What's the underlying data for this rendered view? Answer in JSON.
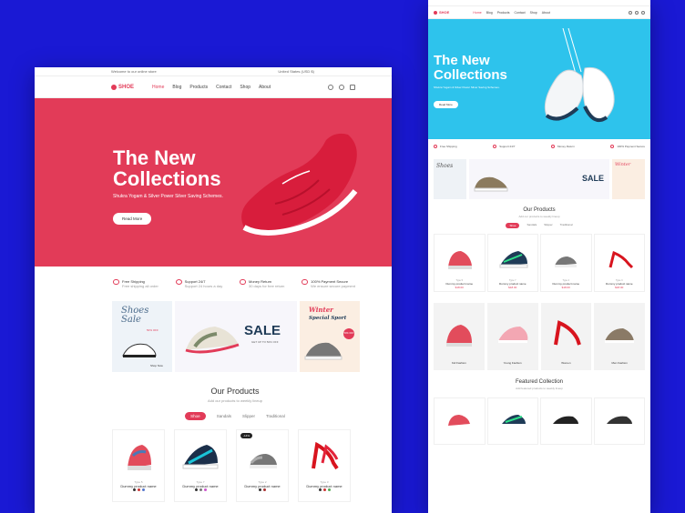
{
  "front": {
    "topbar": {
      "welcome": "Welcome to our online store",
      "region": "United States (USD $)"
    },
    "logo": "SHOE",
    "menu": [
      "Home",
      "Blog",
      "Products",
      "Contact",
      "Shop",
      "About"
    ],
    "hero": {
      "title_line1": "The New",
      "title_line2": "Collections",
      "subtitle": "Shukra Yogam & Silver Power Silver Saving Schemes.",
      "button": "Read More",
      "bg": "#e23b58"
    },
    "features": [
      {
        "title": "Free Shipping",
        "sub": "Free shipping all order"
      },
      {
        "title": "Support 24/7",
        "sub": "Support 24 hours a day"
      },
      {
        "title": "Money Return",
        "sub": "30 days for free return"
      },
      {
        "title": "100% Payment Secure",
        "sub": "We ensure secure payment"
      }
    ],
    "banners": {
      "shoes_sale": {
        "line1": "Shoes",
        "line2": "Sale",
        "badge": "50% OFF",
        "link": "Shop Now"
      },
      "sale": {
        "title": "SALE",
        "sub": "GET UP TO 50% OFF"
      },
      "winter": {
        "line1": "Winter",
        "line2": "Special Sport",
        "badge": "50% OFF"
      }
    },
    "products": {
      "title": "Our Products",
      "subtitle": "Add our products to weekly lineup",
      "tabs": [
        "Shoe",
        "Sandals",
        "Slipper",
        "Traditional"
      ],
      "items": [
        {
          "type": "Type 5",
          "name": "Dummy product name",
          "color": "#e24c5c"
        },
        {
          "type": "Type 7",
          "name": "Dummy product name",
          "color": "#1aa5b8"
        },
        {
          "type": "Type 2",
          "name": "Dummy product name",
          "color": "#888",
          "badge": "-14%"
        },
        {
          "type": "Type 3",
          "name": "Dummy product name",
          "color": "#d8141e"
        }
      ]
    }
  },
  "back": {
    "menu": [
      "Home",
      "Blog",
      "Products",
      "Contact",
      "Shop",
      "About"
    ],
    "hero": {
      "title_line1": "The New",
      "title_line2": "Collections",
      "subtitle": "Shukra Yogam & Silver Power Silver Saving Schemes.",
      "button": "Read More",
      "bg": "#2ec3ec"
    },
    "features": [
      "Free Shipping",
      "Support 24/7",
      "Money Return",
      "100% Payment Secure"
    ],
    "products_title": "Our Products",
    "products_sub": "Add our products to weekly lineup",
    "tabs": [
      "Shoe",
      "Sandals",
      "Slipper",
      "Traditional"
    ],
    "items": [
      {
        "type": "Type 5",
        "name": "Dummy product name",
        "price": "$18.00"
      },
      {
        "type": "Type 7",
        "name": "Dummy product name",
        "price": "$18.00"
      },
      {
        "type": "Type 2",
        "name": "Dummy product name",
        "price": "$18.00"
      },
      {
        "type": "Type 3",
        "name": "Dummy product name",
        "price": "$18.00"
      }
    ],
    "categories": [
      "Kid Fashion",
      "Young Fashion",
      "Women",
      "Men Fashion"
    ],
    "featured_title": "Featured Collection",
    "featured_sub": "Add featured products to weekly lineup"
  },
  "colors": {
    "accent": "#e23b58",
    "page_bg": "#1a19d4"
  }
}
